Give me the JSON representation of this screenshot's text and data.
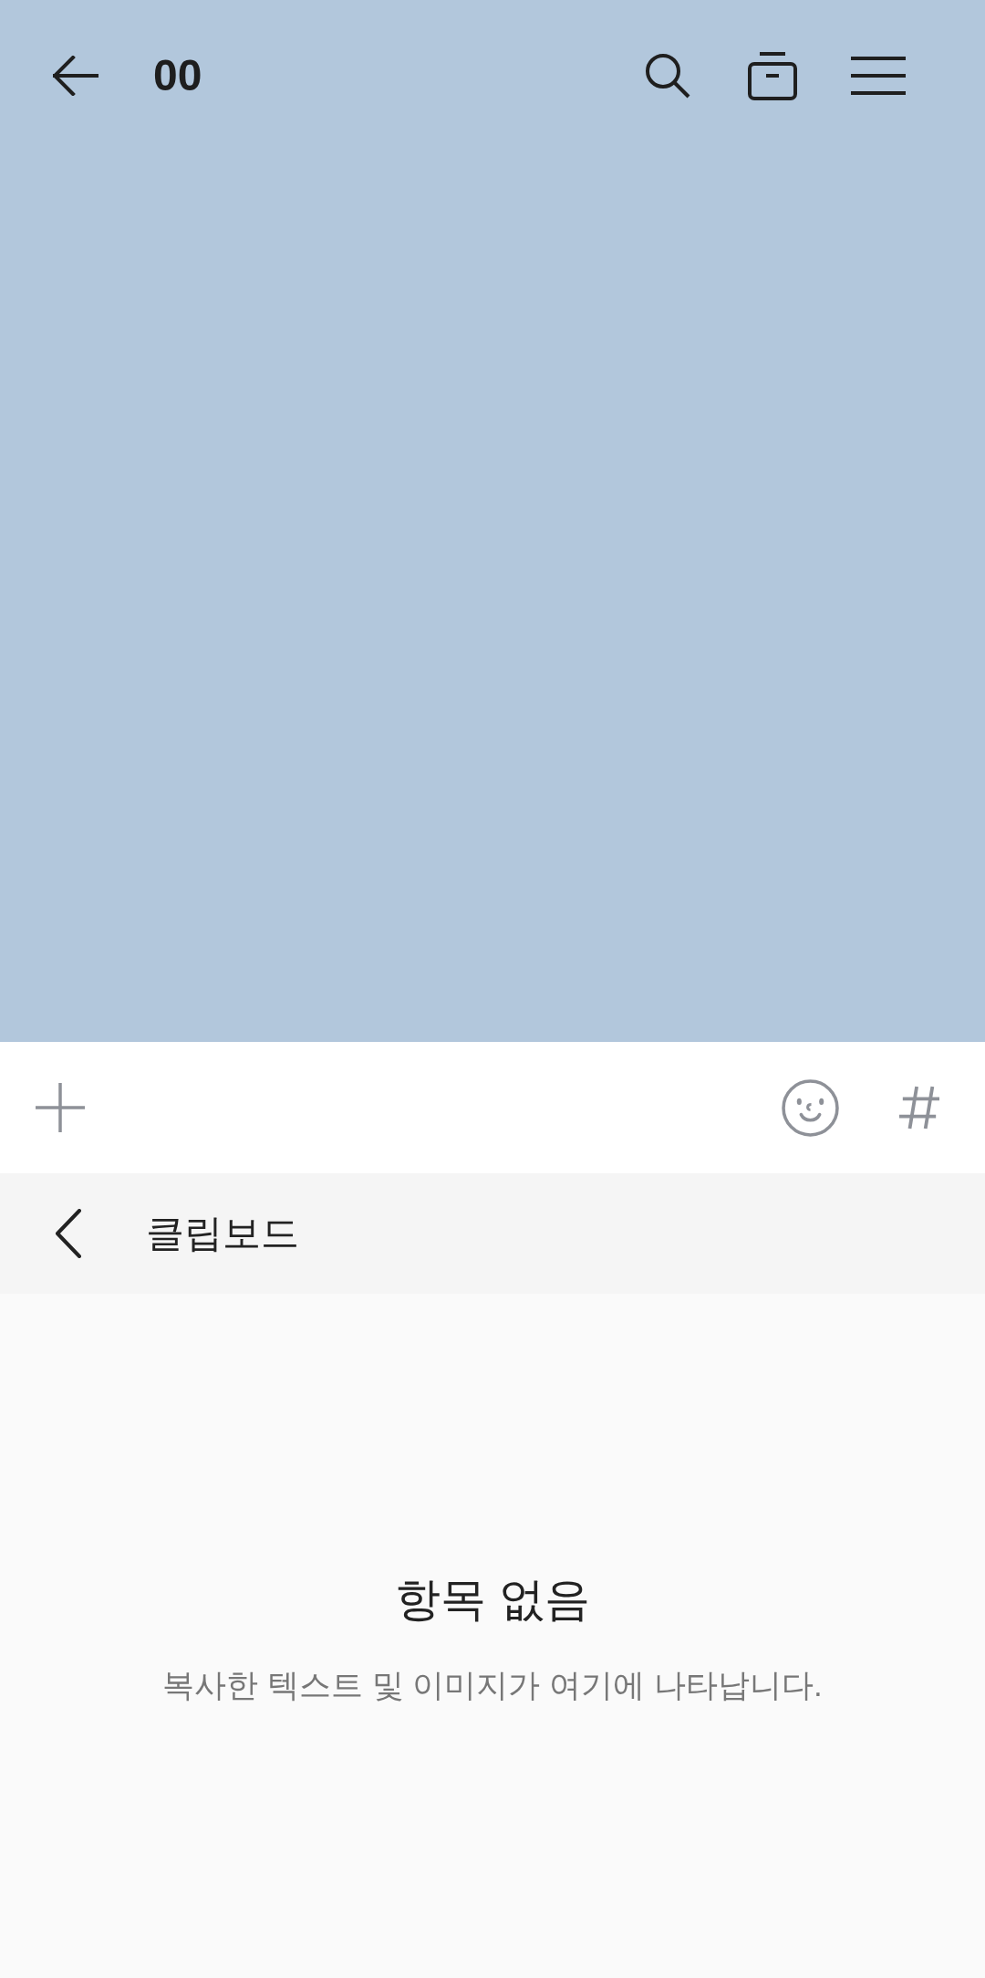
{
  "top_bar": {
    "title": "00"
  },
  "clipboard": {
    "title": "클립보드",
    "empty_title": "항목 없음",
    "empty_message": "복사한 텍스트 및 이미지가 여기에 나타납니다."
  }
}
